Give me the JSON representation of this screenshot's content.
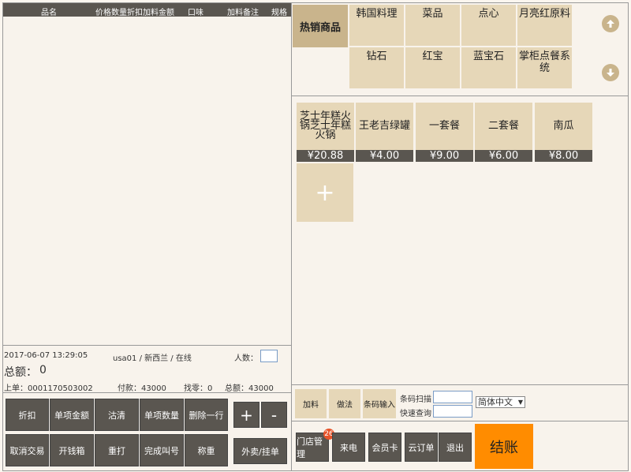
{
  "order": {
    "columns": [
      "品名",
      "价格",
      "数量",
      "折扣",
      "加料",
      "金额",
      "口味",
      "加料备注",
      "规格"
    ]
  },
  "info": {
    "datetime": "2017-06-07 13:29:05",
    "operator": "usa01 / 新西兰 / 在线",
    "people_label": "人数：",
    "total_label": "总额：",
    "total_value": "0",
    "last_order": "上单：0001170503002",
    "paid": "付款：43000",
    "change": "找零：0",
    "sum": "总额：43000"
  },
  "actions": {
    "discount": "折扣",
    "item_amount": "单项金额",
    "clear": "沽清",
    "item_qty": "单项数量",
    "delete_row": "删除一行",
    "plus": "+",
    "minus": "-",
    "cancel_trade": "取消交易",
    "open_drawer": "开钱箱",
    "reprint": "重打",
    "finish_call": "完成叫号",
    "weigh": "称重",
    "takeout": "外卖/挂单"
  },
  "categories": {
    "hot": "热销商品",
    "items": [
      "韩国料理",
      "菜品",
      "点心",
      "月亮红原料",
      "钻石",
      "红宝",
      "蓝宝石",
      "掌柜点餐系统"
    ],
    "up_icon": "arrow-up-icon",
    "down_icon": "arrow-down-icon"
  },
  "goods": [
    {
      "name": "芝士年糕火锅芝士年糕火锅",
      "price": "¥20.88"
    },
    {
      "name": "王老吉绿罐",
      "price": "¥4.00"
    },
    {
      "name": "一套餐",
      "price": "¥9.00"
    },
    {
      "name": "二套餐",
      "price": "¥6.00"
    },
    {
      "name": "南瓜",
      "price": "¥8.00"
    }
  ],
  "add_good": "+",
  "tools": {
    "add_material": "加料",
    "method": "做法",
    "barcode_input": "条码输入",
    "barcode_scan": "条码扫描",
    "quick_search": "快速查询",
    "language": "简体中文"
  },
  "bottom": {
    "store_manage": "门店管理",
    "badge": "26",
    "incoming_call": "来电",
    "member_card": "会员卡",
    "cloud_order": "云订单",
    "exit": "退出",
    "checkout": "结账"
  },
  "colors": {
    "dark_button": "#5a5650",
    "tile": "#e6d7b8",
    "hot_tab": "#c9b48c",
    "checkout": "#ff8c00",
    "badge": "#e8542a"
  }
}
